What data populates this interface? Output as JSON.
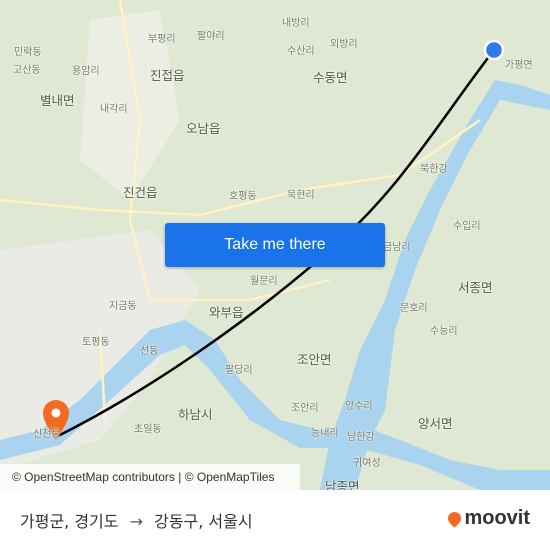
{
  "map": {
    "labels": [
      {
        "text": "내방리"
      },
      {
        "text": "외방리"
      },
      {
        "text": "팔야리"
      },
      {
        "text": "부평리"
      },
      {
        "text": "수산리"
      },
      {
        "text": "민락동"
      },
      {
        "text": "고산동"
      },
      {
        "text": "용암리"
      },
      {
        "text": "진접읍"
      },
      {
        "text": "수동면"
      },
      {
        "text": "별내면"
      },
      {
        "text": "내각리"
      },
      {
        "text": "오남읍"
      },
      {
        "text": "진건읍"
      },
      {
        "text": "호평동"
      },
      {
        "text": "묵현리"
      },
      {
        "text": "금남리"
      },
      {
        "text": "수입리"
      },
      {
        "text": "서종면"
      },
      {
        "text": "문호리"
      },
      {
        "text": "수능리"
      },
      {
        "text": "지금동"
      },
      {
        "text": "월문리"
      },
      {
        "text": "와부읍"
      },
      {
        "text": "토평동"
      },
      {
        "text": "선동"
      },
      {
        "text": "조안면"
      },
      {
        "text": "팔당리"
      },
      {
        "text": "하남시"
      },
      {
        "text": "초일동"
      },
      {
        "text": "조안리"
      },
      {
        "text": "양수리"
      },
      {
        "text": "능내리"
      },
      {
        "text": "양서면"
      },
      {
        "text": "남한강"
      },
      {
        "text": "귀여성"
      },
      {
        "text": "남종면"
      },
      {
        "text": "신천동"
      },
      {
        "text": "북한강"
      },
      {
        "text": "가평면"
      }
    ],
    "origin_marker_color": "#2b7de9",
    "destination_marker_color": "#f26b21",
    "route_color": "#000000"
  },
  "cta": {
    "label": "Take me there"
  },
  "attribution": "© OpenStreetMap contributors | © OpenMapTiles",
  "footer": {
    "origin": "가평군, 경기도",
    "arrow": "→",
    "destination": "강동구, 서울시",
    "logo": "moovit"
  }
}
